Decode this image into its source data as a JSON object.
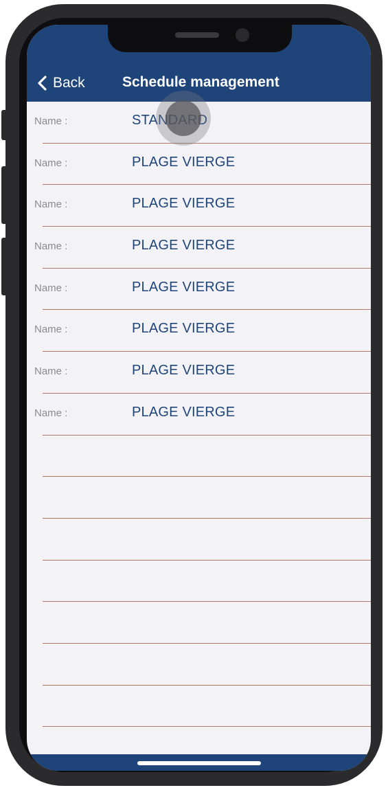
{
  "nav": {
    "back_label": "Back",
    "title": "Schedule management"
  },
  "rows": [
    {
      "label": "Name :",
      "value": "STANDARD"
    },
    {
      "label": "Name :",
      "value": "PLAGE VIERGE"
    },
    {
      "label": "Name :",
      "value": "PLAGE VIERGE"
    },
    {
      "label": "Name :",
      "value": "PLAGE VIERGE"
    },
    {
      "label": "Name :",
      "value": "PLAGE VIERGE"
    },
    {
      "label": "Name :",
      "value": "PLAGE VIERGE"
    },
    {
      "label": "Name :",
      "value": "PLAGE VIERGE"
    },
    {
      "label": "Name :",
      "value": "PLAGE VIERGE"
    }
  ],
  "colors": {
    "brand_blue": "#1e4479",
    "separator": "#b07a68",
    "background": "#f3f3f7"
  }
}
